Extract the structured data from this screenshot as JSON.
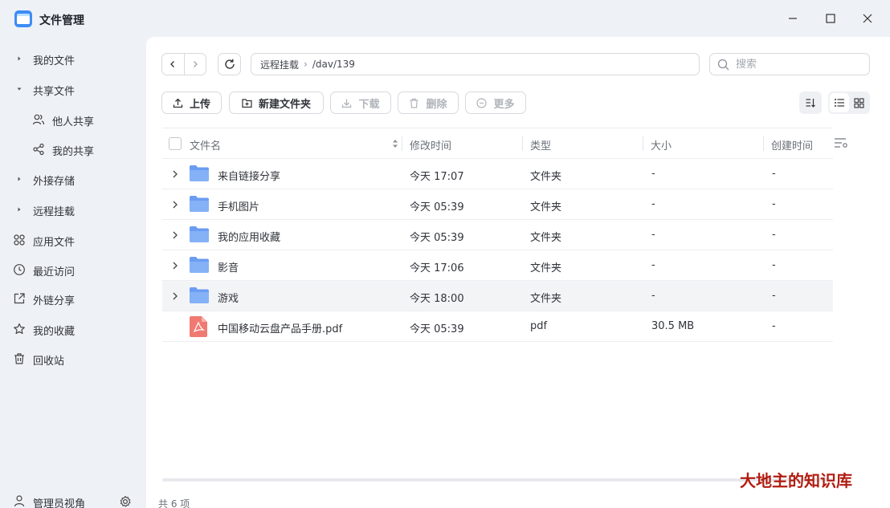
{
  "window": {
    "title": "文件管理",
    "controls": [
      "minimize-icon",
      "maximize-icon",
      "close-icon"
    ]
  },
  "sidebar": {
    "items": [
      {
        "label": "我的文件",
        "icon": "arrow-right-icon"
      },
      {
        "label": "共享文件",
        "icon": "arrow-down-icon"
      },
      {
        "label": "他人共享",
        "icon": "users-icon"
      },
      {
        "label": "我的共享",
        "icon": "share-icon"
      },
      {
        "label": "外接存储",
        "icon": "arrow-right-icon"
      },
      {
        "label": "远程挂载",
        "icon": "arrow-right-icon"
      },
      {
        "label": "应用文件",
        "icon": "apps-icon"
      },
      {
        "label": "最近访问",
        "icon": "clock-icon"
      },
      {
        "label": "外链分享",
        "icon": "external-link-icon"
      },
      {
        "label": "我的收藏",
        "icon": "star-icon"
      },
      {
        "label": "回收站",
        "icon": "trash-icon"
      }
    ],
    "admin_label": "管理员视角"
  },
  "path": {
    "segments": [
      "远程挂载",
      "/dav/139"
    ],
    "separator": "›"
  },
  "search": {
    "placeholder": "搜索"
  },
  "toolbar": {
    "upload": "上传",
    "new_folder": "新建文件夹",
    "download": "下载",
    "delete": "删除",
    "more": "更多"
  },
  "table": {
    "headers": {
      "name": "文件名",
      "modified": "修改时间",
      "type": "类型",
      "size": "大小",
      "created": "创建时间"
    },
    "rows": [
      {
        "name": "来自链接分享",
        "modified": "今天 17:07",
        "type": "文件夹",
        "size": "-",
        "created": "-",
        "icon": "folder-icon"
      },
      {
        "name": "手机图片",
        "modified": "今天 05:39",
        "type": "文件夹",
        "size": "-",
        "created": "-",
        "icon": "folder-icon"
      },
      {
        "name": "我的应用收藏",
        "modified": "今天 05:39",
        "type": "文件夹",
        "size": "-",
        "created": "-",
        "icon": "folder-icon"
      },
      {
        "name": "影音",
        "modified": "今天 17:06",
        "type": "文件夹",
        "size": "-",
        "created": "-",
        "icon": "folder-icon"
      },
      {
        "name": "游戏",
        "modified": "今天 18:00",
        "type": "文件夹",
        "size": "-",
        "created": "-",
        "icon": "folder-icon"
      },
      {
        "name": "中国移动云盘产品手册.pdf",
        "modified": "今天 05:39",
        "type": "pdf",
        "size": "30.5 MB",
        "created": "-",
        "icon": "pdf-icon"
      }
    ]
  },
  "footer": {
    "count": "共 6 项"
  },
  "watermark": "大地主的知识库",
  "colors": {
    "accent": "#2f7cf6",
    "folder": "#7aa8f5",
    "pdf": "#f07a72",
    "watermark": "#b21d12"
  }
}
